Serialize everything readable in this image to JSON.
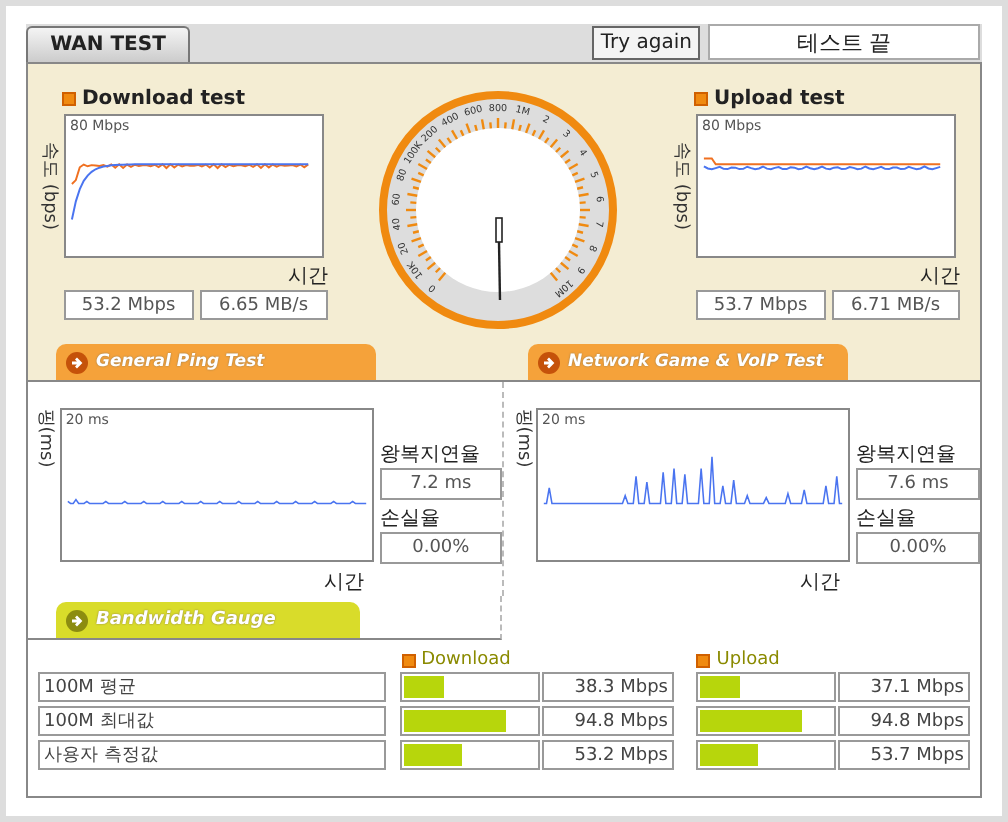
{
  "tab": "WAN TEST",
  "try_again": "Try again",
  "status": "테스트 끝",
  "speed_tests": [
    {
      "title": "Download test",
      "axis_label": "속도 (bps)",
      "scale": "80 Mbps",
      "time_label": "시간",
      "rate": "53.2 Mbps",
      "throughput": "6.65 MB/s",
      "kind": "download"
    },
    {
      "title": "Upload test",
      "axis_label": "속도 (bps)",
      "scale": "80 Mbps",
      "time_label": "시간",
      "rate": "53.7 Mbps",
      "throughput": "6.71 MB/s",
      "kind": "upload"
    }
  ],
  "gauge": {
    "labels": [
      "0",
      "10K",
      "20",
      "40",
      "60",
      "80",
      "100K",
      "200",
      "400",
      "600",
      "800",
      "1M",
      "2",
      "3",
      "4",
      "5",
      "6",
      "7",
      "8",
      "9",
      "10M"
    ]
  },
  "ping_tests": [
    {
      "title": "General Ping Test",
      "axis_label": "핑(ms)",
      "scale": "20 ms",
      "time_label": "시간",
      "latency_label": "왕복지연율",
      "latency": "7.2 ms",
      "loss_label": "손실율",
      "loss": "0.00%",
      "kind": "flat"
    },
    {
      "title": "Network Game & VoIP Test",
      "axis_label": "핑(ms)",
      "scale": "20 ms",
      "time_label": "시간",
      "latency_label": "왕복지연율",
      "latency": "7.6 ms",
      "loss_label": "손실율",
      "loss": "0.00%",
      "kind": "spiky"
    }
  ],
  "bandwidth": {
    "title": "Bandwidth Gauge",
    "download_header": "Download",
    "upload_header": "Upload",
    "rows": [
      {
        "label": "100M 평균",
        "download": {
          "level": 0.3,
          "value": "38.3 Mbps"
        },
        "upload": {
          "level": 0.3,
          "value": "37.1 Mbps"
        }
      },
      {
        "label": "100M 최대값",
        "download": {
          "level": 0.78,
          "value": "94.8 Mbps"
        },
        "upload": {
          "level": 0.78,
          "value": "94.8 Mbps"
        }
      },
      {
        "label": "사용자 측정값",
        "download": {
          "level": 0.44,
          "value": "53.2 Mbps"
        },
        "upload": {
          "level": 0.44,
          "value": "53.7 Mbps"
        }
      }
    ]
  }
}
